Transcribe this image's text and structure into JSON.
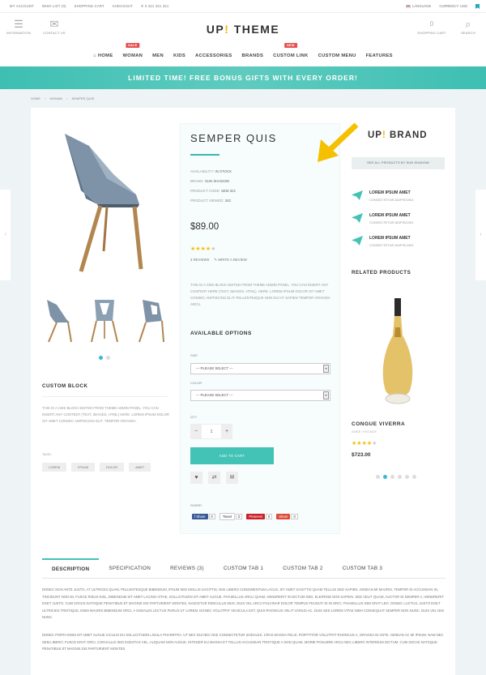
{
  "topbar": {
    "links": [
      "MY ACCOUNT",
      "WISH LIST (0)",
      "SHOPPING CART",
      "CHECKOUT"
    ],
    "phone": "0 321 321 321",
    "language": "LANGUAGE",
    "currency": "CURRENCY: USD"
  },
  "header": {
    "logo_main": "UP",
    "logo_mark": "!",
    "logo_rest": " THEME",
    "information": "INFORMATION",
    "contact": "CONTACT US",
    "cart": "SHOPPING CART",
    "cart_count": "0",
    "search": "SEARCH"
  },
  "nav": {
    "items": [
      {
        "label": "HOME",
        "badge": ""
      },
      {
        "label": "WOMAN",
        "badge": "SALE"
      },
      {
        "label": "MEN",
        "badge": ""
      },
      {
        "label": "KIDS",
        "badge": ""
      },
      {
        "label": "ACCESSORIES",
        "badge": ""
      },
      {
        "label": "BRANDS",
        "badge": ""
      },
      {
        "label": "CUSTOM LINK",
        "badge": "NEW"
      },
      {
        "label": "CUSTOM MENU",
        "badge": ""
      },
      {
        "label": "FEATURES",
        "badge": ""
      }
    ]
  },
  "banner": "LIMITED TIME! FREE BONUS GIFTS WITH EVERY ORDER!",
  "breadcrumb": [
    "HOME",
    "WOMAN",
    "SEMPER QUIS"
  ],
  "product": {
    "title": "SEMPER QUIS",
    "availability_label": "AVAILABILITY:",
    "availability": "IN STOCK",
    "brand_label": "BRAND:",
    "brand": "SUN SHADOW",
    "code_label": "PRODUCT CODE:",
    "code": "SEM 321",
    "viewed_label": "PRODUCT VIEWED:",
    "viewed": "342",
    "price": "$89.00",
    "rating": 4,
    "reviews": "3 REVIEWS",
    "write_review": "WRITE A REVIEW",
    "description": "THIS IS A CMS BLOCK EDITED FROM THEME ADMIN PANEL. YOU CAN INSERT ANY CONTENT HERE (TEXT, IMAGES, HTML). HERE. LOREM IPSUM DOLOR SIT AMET CONSEC ADIPISCING ELIT. PELLENTESQUE NON DUI AT SAPIEN TEMPOR GRAVIDA ARCU."
  },
  "options": {
    "title": "AVAILABLE OPTIONS",
    "size_label": "SIZE",
    "size_value": "--- PLEASE SELECT ---",
    "color_label": "COLOR",
    "color_value": "--- PLEASE SELECT ---",
    "qty_label": "QTY",
    "qty": "1",
    "minus": "−",
    "plus": "+",
    "add_to_cart": "ADD TO CART"
  },
  "share": {
    "label": "SHARE:",
    "buttons": [
      {
        "label": "f Share",
        "count": "0",
        "color": "#3b5998"
      },
      {
        "label": "Tweet",
        "count": "0",
        "color": "#ffffff"
      },
      {
        "label": "Pinterest",
        "count": "0",
        "color": "#cb2027"
      },
      {
        "label": "Share",
        "count": "0",
        "color": "#dd4b39"
      }
    ]
  },
  "custom_block": {
    "title": "CUSTOM BLOCK",
    "text": "THIS IS A CMS BLOCK EDITED FROM THEME ADMIN PANEL. YOU CAN INSERT ANY CONTENT (TEXT, IMAGES, HTML) HERE. LOREM IPSUM DOLOR SIT AMET CONSEC ADIPISCING ELIT. TEMPOR GRAVIDA.",
    "tags_label": "TAGS:",
    "tags": [
      "LOREM",
      "IPSUM",
      "DOLOR",
      "AMET"
    ]
  },
  "brand_panel": {
    "logo_main": "UP",
    "logo_mark": "!",
    "logo_rest": " BRAND",
    "see_all": "SEE ALL PRODUCTS BY SUN SHADOW",
    "features": [
      {
        "title": "LOREM IPSUM AMET",
        "sub": "CONSECTETUR ADIPISCING"
      },
      {
        "title": "LOREM IPSUM AMET",
        "sub": "CONSECTETUR ADIPISCING"
      },
      {
        "title": "LOREM IPSUM AMET",
        "sub": "CONSECTETUR ADIPISCING"
      }
    ]
  },
  "related": {
    "title": "RELATED PRODUCTS",
    "name": "CONGUE VIVERRA",
    "sub": "ANEE VINTAGE",
    "rating": 4,
    "price": "$723.00"
  },
  "tabs": {
    "items": [
      "DESCRIPTION",
      "SPECIFICATION",
      "REVIEWS (3)",
      "CUSTOM TAB 1",
      "CUSTOM TAB 2",
      "CUSTOM TAB 3"
    ],
    "p1": "DONEC NON ANTE JUSTO, AT ULTRICES QUAM. PELLENTESQUE BIBENDUM, IPSUM SED MOLLIS SAGITTIS, NISI LIBERO CONDIMENTUM LACUS, SIT AMET SAGITTIS QUAM TELLUS SED SAPIEN. AENEAN MI MAURIS, TEMPOR ID ACCUMSAN IN, TINCIDUNT NON MI. FUSCE RISUS NISL, BIBENDUM SIT AMET LACINIA VITAE, SOLLICITUDIN SIT AMET AUGUE. PHASELLUS ARCU QUAM, HENDRERIT IN DICTUM SED, ELEIFEND NON SAPIEN. SED VELIT QUAM, AUCTOR ID SEMPER A, HENDRERIT EGET JUSTO. CUM SOCIIS NATOQUE PENATIBUS ET MAGNIS DIS PARTURIENT MONTES, NASCETUR RIDICULUS MUS. DUIS VEL ARCU PULVINAR DOLOR TEMPUS FEUGIAT ID IN ORCI. PHASELLUS SED ERAT LEO. DONEC LUCTUS, JUSTO EGET ULTRICIES TRISTIQUE, ENIM MAURIS BIBENDUM ORCI, A SODALES LECTUS PURUS UT LOREM. DONEC VOLUTPAT VEHICULA EST, QUIS RHONCUS VELIT VARIUS AC. DUIS SED LOREM VITAE NIBH CONSEQUAT SEMPER NON NUNC. DUIS VEL NISI NUNC.",
    "p2": "DONEC PORTA ENIM SIT AMET AUGUE IACULIS EU SOLLICITUDIN LIGULA PHARETRA. UT NEC DUI NEC NISI CONSECTETUR SODALES. CRAS MAGNA FELIS, PORTTITOR VOLUTPAT RHONCUS A, GRAVIDA ID ANTE. AENEAN AC MI IPSUM. NAM NEC SEM LIBERO. FUSCE ERAT ORCI, CONVALLIS SED EGESTAS VEL, ALIQUAM NON AUGUE. INTEGER EU MAGNA ET TELLUS ACCUMSAN TRISTIQUE A NON QUAM. MORBI POSUERE ARCU NEC LIBERO INTERDUM DICTUM. CUM SOCIIS NATOQUE PENATIBUS ET MAGNIS DIS PARTURIENT MONTES."
  },
  "colors": {
    "accent": "#43c2b6",
    "star": "#f5c000",
    "sale": "#e65050",
    "dot_active": "#38b8d8",
    "arrow": "#f5c000"
  }
}
